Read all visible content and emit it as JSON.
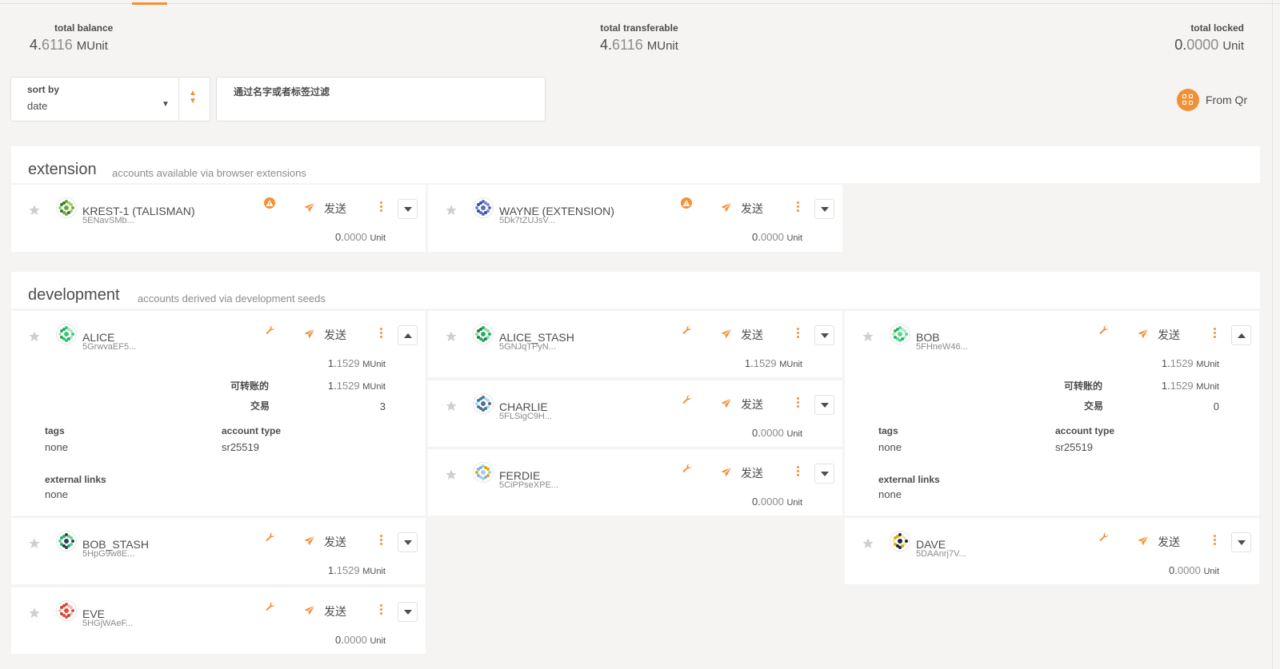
{
  "summary": {
    "total_balance": {
      "label": "total balance",
      "int": "4.",
      "frac": "6116",
      "unit": "MUnit"
    },
    "total_transferable": {
      "label": "total transferable",
      "int": "4.",
      "frac": "6116",
      "unit": "MUnit"
    },
    "total_locked": {
      "label": "total locked",
      "int": "0.",
      "frac": "0000",
      "unit": "Unit"
    }
  },
  "controls": {
    "sort_label": "sort by",
    "sort_value": "date",
    "filter_placeholder": "通过名字或者标签过滤",
    "from_qr": "From Qr"
  },
  "sections": {
    "extension": {
      "title": "extension",
      "desc": "accounts available via browser extensions"
    },
    "development": {
      "title": "development",
      "desc": "accounts derived via development seeds"
    }
  },
  "send_label": "发送",
  "colors": {
    "accent": "#f19135",
    "text": "#4d4d4d",
    "muted": "#8c8b8b"
  },
  "accounts": {
    "krest": {
      "name": "KREST-1 (TALISMAN)",
      "address": "5ENavSMb...",
      "bal_int": "0.",
      "bal_frac": "0000",
      "bal_unit": "Unit",
      "badge": "warning-icon",
      "expanded": false
    },
    "wayne": {
      "name": "WAYNE (EXTENSION)",
      "address": "5Dk7tZUJsV...",
      "bal_int": "0.",
      "bal_frac": "0000",
      "bal_unit": "Unit",
      "badge": "warning-icon",
      "expanded": false
    },
    "alice": {
      "name": "ALICE",
      "address": "5GrwvaEF5...",
      "bal_int": "1.",
      "bal_frac": "1529",
      "bal_unit": "MUnit",
      "badge": "wrench-icon",
      "expanded": true,
      "transferable_label": "可转账的",
      "transferable_int": "1.",
      "transferable_frac": "1529",
      "transferable_unit": "MUnit",
      "tx_label": "交易",
      "tx_count": "3",
      "tags_label": "tags",
      "tags_value": "none",
      "type_label": "account type",
      "type_value": "sr25519",
      "links_label": "external links",
      "links_value": "none"
    },
    "alice_stash": {
      "name": "ALICE_STASH",
      "address": "5GNJqTPyN...",
      "bal_int": "1.",
      "bal_frac": "1529",
      "bal_unit": "MUnit",
      "badge": "wrench-icon",
      "expanded": false
    },
    "bob": {
      "name": "BOB",
      "address": "5FHneW46...",
      "bal_int": "1.",
      "bal_frac": "1529",
      "bal_unit": "MUnit",
      "badge": "wrench-icon",
      "expanded": true,
      "transferable_label": "可转账的",
      "transferable_int": "1.",
      "transferable_frac": "1529",
      "transferable_unit": "MUnit",
      "tx_label": "交易",
      "tx_count": "0",
      "tags_label": "tags",
      "tags_value": "none",
      "type_label": "account type",
      "type_value": "sr25519",
      "links_label": "external links",
      "links_value": "none"
    },
    "charlie": {
      "name": "CHARLIE",
      "address": "5FLSigC9H...",
      "bal_int": "0.",
      "bal_frac": "0000",
      "bal_unit": "Unit",
      "badge": "wrench-icon",
      "expanded": false
    },
    "ferdie": {
      "name": "FERDIE",
      "address": "5CiPPseXPE...",
      "bal_int": "0.",
      "bal_frac": "0000",
      "bal_unit": "Unit",
      "badge": "wrench-icon",
      "expanded": false
    },
    "bob_stash": {
      "name": "BOB_STASH",
      "address": "5HpG9w8E...",
      "bal_int": "1.",
      "bal_frac": "1529",
      "bal_unit": "MUnit",
      "badge": "wrench-icon",
      "expanded": false
    },
    "dave": {
      "name": "DAVE",
      "address": "5DAAnrj7V...",
      "bal_int": "0.",
      "bal_frac": "0000",
      "bal_unit": "Unit",
      "badge": "wrench-icon",
      "expanded": false
    },
    "eve": {
      "name": "EVE",
      "address": "5HGjWAeF...",
      "bal_int": "0.",
      "bal_frac": "0000",
      "bal_unit": "Unit",
      "badge": "wrench-icon",
      "expanded": false
    }
  }
}
